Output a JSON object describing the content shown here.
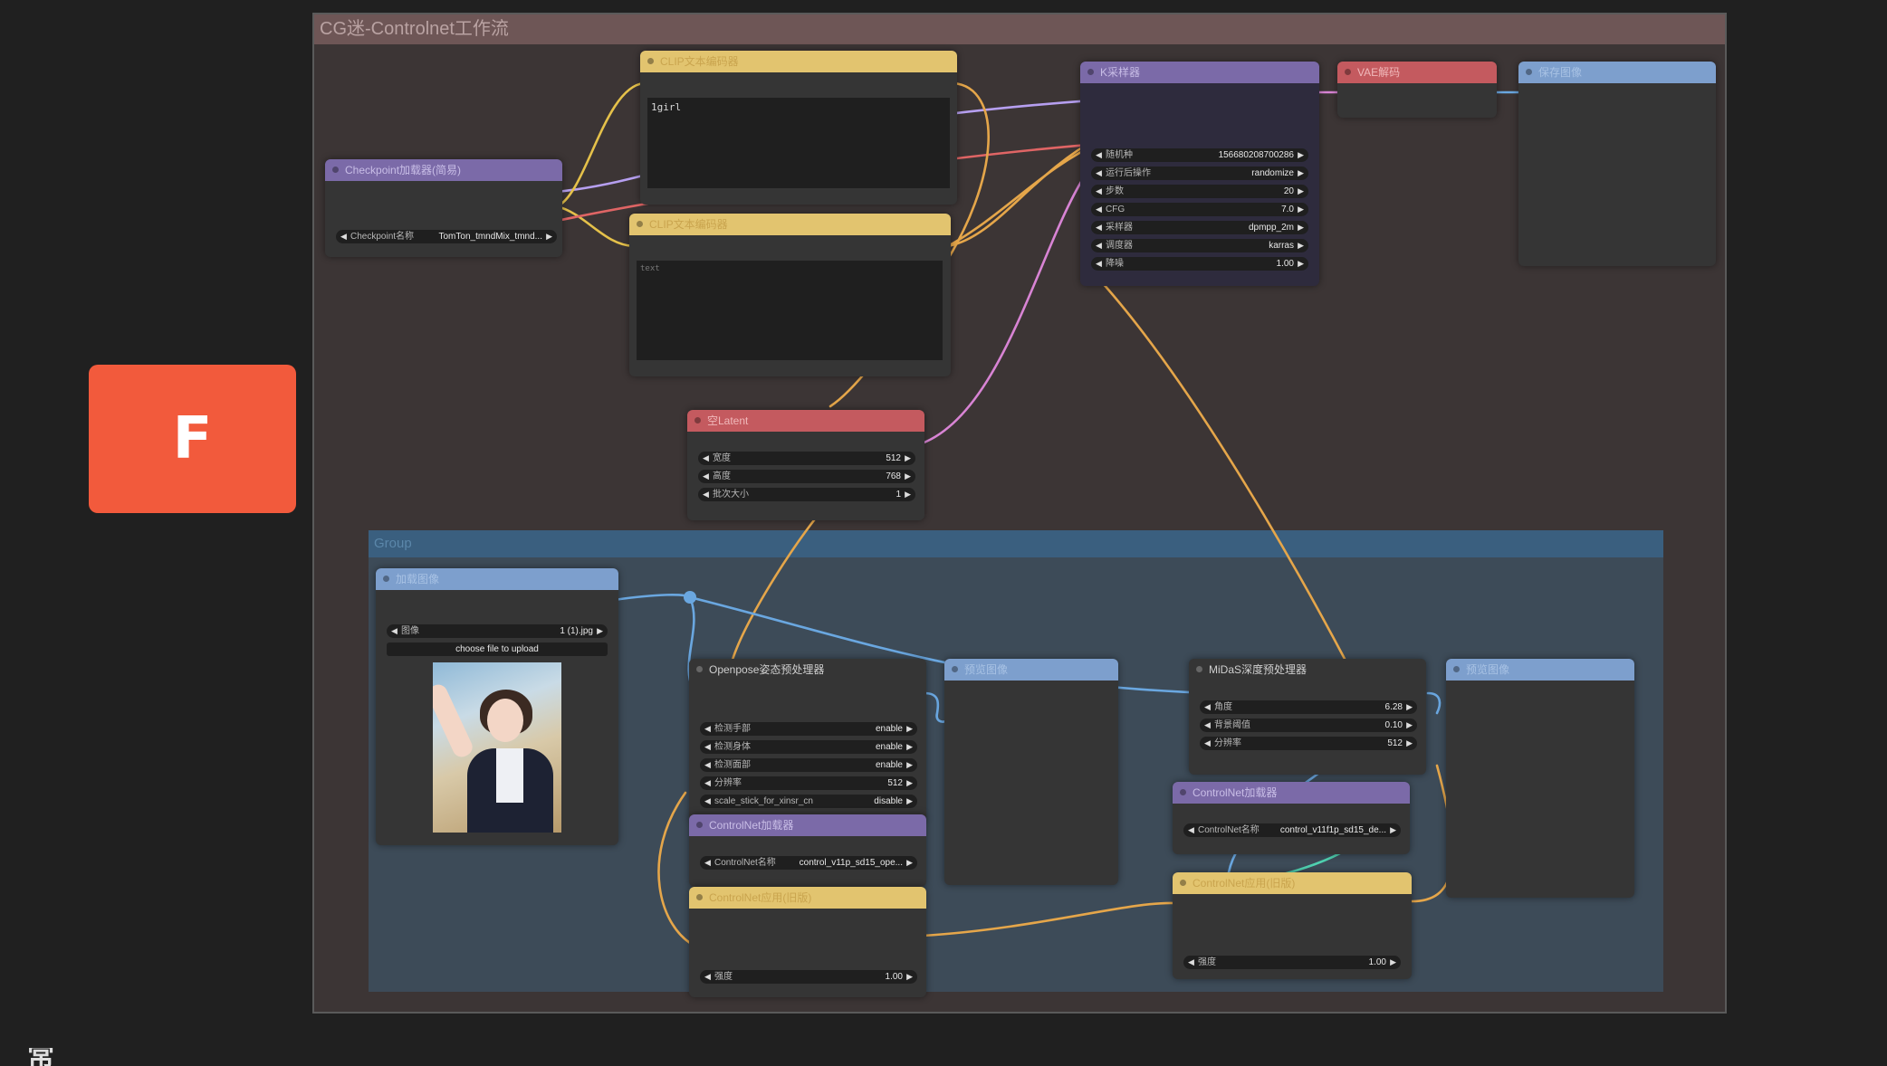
{
  "side_badge": {
    "letter": "F"
  },
  "corner_glyph": "常",
  "workflow": {
    "title": "CG迷-Controlnet工作流"
  },
  "group": {
    "title": "Group"
  },
  "nodes": {
    "clip_pos": {
      "title": "CLIP文本编码器",
      "text": "1girl"
    },
    "clip_neg": {
      "title": "CLIP文本编码器",
      "text": "text"
    },
    "checkpoint": {
      "title": "Checkpoint加载器(简易)",
      "widget_label": "Checkpoint名称",
      "widget_value": "TomTon_tmndMix_tmnd..."
    },
    "ksampler": {
      "title": "K采样器",
      "widgets": [
        {
          "label": "随机种",
          "value": "156680208700286"
        },
        {
          "label": "运行后操作",
          "value": "randomize"
        },
        {
          "label": "步数",
          "value": "20"
        },
        {
          "label": "CFG",
          "value": "7.0"
        },
        {
          "label": "采样器",
          "value": "dpmpp_2m"
        },
        {
          "label": "调度器",
          "value": "karras"
        },
        {
          "label": "降噪",
          "value": "1.00"
        }
      ]
    },
    "vae_decode": {
      "title": "VAE解码"
    },
    "save_image": {
      "title": "保存图像"
    },
    "empty_latent": {
      "title": "空Latent",
      "widgets": [
        {
          "label": "宽度",
          "value": "512"
        },
        {
          "label": "高度",
          "value": "768"
        },
        {
          "label": "批次大小",
          "value": "1"
        }
      ]
    },
    "load_image": {
      "title": "加载图像",
      "widget_label": "图像",
      "widget_value": "1 (1).jpg",
      "upload_label": "choose file to upload"
    },
    "openpose": {
      "title": "Openpose姿态预处理器",
      "widgets": [
        {
          "label": "检测手部",
          "value": "enable"
        },
        {
          "label": "检测身体",
          "value": "enable"
        },
        {
          "label": "检测面部",
          "value": "enable"
        },
        {
          "label": "分辨率",
          "value": "512"
        },
        {
          "label": "scale_stick_for_xinsr_cn",
          "value": "disable"
        }
      ]
    },
    "cn_loader1": {
      "title": "ControlNet加载器",
      "widget_label": "ControlNet名称",
      "widget_value": "control_v11p_sd15_ope..."
    },
    "cn_apply1": {
      "title": "ControlNet应用(旧版)",
      "widget_label": "强度",
      "widget_value": "1.00"
    },
    "preview1": {
      "title": "预览图像"
    },
    "midas": {
      "title": "MiDaS深度预处理器",
      "widgets": [
        {
          "label": "角度",
          "value": "6.28"
        },
        {
          "label": "背景阈值",
          "value": "0.10"
        },
        {
          "label": "分辨率",
          "value": "512"
        }
      ]
    },
    "cn_loader2": {
      "title": "ControlNet加载器",
      "widget_label": "ControlNet名称",
      "widget_value": "control_v11f1p_sd15_de..."
    },
    "cn_apply2": {
      "title": "ControlNet应用(旧版)",
      "widget_label": "强度",
      "widget_value": "1.00"
    },
    "preview2": {
      "title": "预览图像"
    }
  },
  "colors": {
    "yellow_header": "#e2c46f",
    "purple_header": "#7b6aa8",
    "red_header": "#c45a5f",
    "blue_header": "#7d9fcd",
    "wire_orange": "#e5a64a",
    "wire_pink": "#d884d4",
    "wire_blue": "#6aa7e0",
    "wire_teal": "#4fd1b0",
    "wire_purple": "#b69ff0",
    "wire_red": "#e06565",
    "badge": "#f25a3c"
  }
}
